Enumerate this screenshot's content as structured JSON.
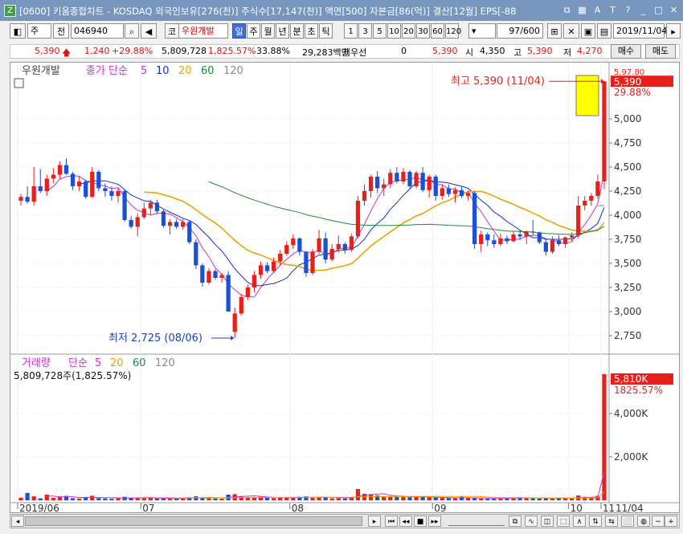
{
  "window": {
    "badge": "Z",
    "title": "[0600] 키움종합차트 - KOSDAQ 외국인보유[276(천)] 주식수[17,147(천)] 액면[500] 자본금[86(억)] 결산[12월] EPS[-88",
    "icons": [
      "restore-icon",
      "grid-icon",
      "font-size-icon",
      "help-icon",
      "settings-icon",
      "minimize-icon",
      "maximize-icon",
      "close-icon"
    ],
    "icon_glyphs": [
      "⧉",
      "▦",
      "A",
      "T",
      "?",
      "_",
      "□",
      "✕"
    ]
  },
  "toolbar": {
    "period_select": "주",
    "prev_button": "전",
    "code_value": "046940",
    "market_badge": "코",
    "stock_name": "우원개발",
    "tabs": [
      "일",
      "주",
      "월",
      "년",
      "분",
      "초",
      "틱"
    ],
    "active_tab": "일",
    "minute_steps": [
      "1",
      "3",
      "5",
      "10",
      "20",
      "30",
      "60",
      "120"
    ],
    "count_value": "97/600",
    "date_value": "2019/11/04",
    "buy_button": "매수",
    "sell_button": "매도"
  },
  "quote": {
    "price": "5,390",
    "change": "1,240",
    "change_pct": "+29.88%",
    "volume": "5,809,728",
    "volume_pct": "1,825.57%",
    "turnover_pct": "33.88%",
    "amount": "29,283백만",
    "priority_label": "최우선",
    "priority_value": "0",
    "ask": "5,390",
    "open_label": "시",
    "open": "4,350",
    "high_label": "고",
    "high": "5,390",
    "low_label": "저",
    "low": "4,270"
  },
  "chart_data": [
    {
      "type": "candlestick",
      "legend_name": "우원개발",
      "ma_label": "종가 단순",
      "ma_periods": [
        "5",
        "10",
        "20",
        "60",
        "120"
      ],
      "ma_colors": [
        "#cc2fcc",
        "#1a2bd0",
        "#e8a400",
        "#1f8a3a",
        "#8a8a8a"
      ],
      "ylim": [
        2600,
        5500
      ],
      "y_ticks": [
        2750,
        3000,
        3250,
        3500,
        3750,
        4000,
        4250,
        4500,
        4750,
        5000
      ],
      "y_tick_labels": [
        "2,750",
        "3,000",
        "3,250",
        "3,500",
        "3,750",
        "4,000",
        "4,250",
        "4,500",
        "4,750",
        "5,000"
      ],
      "last_price_label": "5,390",
      "last_price_pct": "29.88%",
      "top_hint": "5,97.80",
      "high_annotation": "최고 5,390 (11/04)",
      "low_annotation": "최저 2,725 (08/06)",
      "x_labels": [
        "2019/06",
        "07",
        "08",
        "09",
        "10",
        "11",
        "11/04"
      ],
      "candles": [
        {
          "o": 4150,
          "h": 4220,
          "l": 4100,
          "c": 4190
        },
        {
          "o": 4190,
          "h": 4300,
          "l": 4120,
          "c": 4140
        },
        {
          "o": 4140,
          "h": 4500,
          "l": 4100,
          "c": 4300
        },
        {
          "o": 4300,
          "h": 4480,
          "l": 4230,
          "c": 4250
        },
        {
          "o": 4250,
          "h": 4420,
          "l": 4200,
          "c": 4380
        },
        {
          "o": 4380,
          "h": 4490,
          "l": 4330,
          "c": 4420
        },
        {
          "o": 4420,
          "h": 4560,
          "l": 4380,
          "c": 4520
        },
        {
          "o": 4520,
          "h": 4590,
          "l": 4420,
          "c": 4430
        },
        {
          "o": 4430,
          "h": 4450,
          "l": 4260,
          "c": 4300
        },
        {
          "o": 4300,
          "h": 4400,
          "l": 4250,
          "c": 4350
        },
        {
          "o": 4350,
          "h": 4370,
          "l": 4170,
          "c": 4190
        },
        {
          "o": 4190,
          "h": 4500,
          "l": 4180,
          "c": 4450
        },
        {
          "o": 4450,
          "h": 4470,
          "l": 4250,
          "c": 4280
        },
        {
          "o": 4280,
          "h": 4330,
          "l": 4190,
          "c": 4250
        },
        {
          "o": 4250,
          "h": 4300,
          "l": 4150,
          "c": 4200
        },
        {
          "o": 4200,
          "h": 4280,
          "l": 4130,
          "c": 4250
        },
        {
          "o": 4250,
          "h": 4260,
          "l": 3930,
          "c": 3950
        },
        {
          "o": 3950,
          "h": 3990,
          "l": 3860,
          "c": 3880
        },
        {
          "o": 3880,
          "h": 4020,
          "l": 3780,
          "c": 3980
        },
        {
          "o": 3980,
          "h": 4130,
          "l": 3960,
          "c": 4070
        },
        {
          "o": 4070,
          "h": 4160,
          "l": 4000,
          "c": 4130
        },
        {
          "o": 4130,
          "h": 4160,
          "l": 4010,
          "c": 4040
        },
        {
          "o": 4040,
          "h": 4060,
          "l": 3870,
          "c": 3890
        },
        {
          "o": 3890,
          "h": 3960,
          "l": 3800,
          "c": 3930
        },
        {
          "o": 3930,
          "h": 3960,
          "l": 3860,
          "c": 3880
        },
        {
          "o": 3880,
          "h": 3960,
          "l": 3850,
          "c": 3930
        },
        {
          "o": 3930,
          "h": 3950,
          "l": 3700,
          "c": 3720
        },
        {
          "o": 3720,
          "h": 3750,
          "l": 3440,
          "c": 3480
        },
        {
          "o": 3480,
          "h": 3500,
          "l": 3260,
          "c": 3300
        },
        {
          "o": 3300,
          "h": 3450,
          "l": 3280,
          "c": 3420
        },
        {
          "o": 3420,
          "h": 3440,
          "l": 3330,
          "c": 3350
        },
        {
          "o": 3350,
          "h": 3400,
          "l": 3300,
          "c": 3380
        },
        {
          "o": 3380,
          "h": 3420,
          "l": 3000,
          "c": 3000
        },
        {
          "o": 2790,
          "h": 3040,
          "l": 2725,
          "c": 2980
        },
        {
          "o": 2980,
          "h": 3180,
          "l": 2960,
          "c": 3150
        },
        {
          "o": 3150,
          "h": 3280,
          "l": 3120,
          "c": 3250
        },
        {
          "o": 3250,
          "h": 3420,
          "l": 3200,
          "c": 3380
        },
        {
          "o": 3380,
          "h": 3520,
          "l": 3340,
          "c": 3480
        },
        {
          "o": 3480,
          "h": 3510,
          "l": 3400,
          "c": 3420
        },
        {
          "o": 3420,
          "h": 3560,
          "l": 3400,
          "c": 3520
        },
        {
          "o": 3520,
          "h": 3640,
          "l": 3480,
          "c": 3600
        },
        {
          "o": 3600,
          "h": 3730,
          "l": 3580,
          "c": 3690
        },
        {
          "o": 3690,
          "h": 3800,
          "l": 3650,
          "c": 3760
        },
        {
          "o": 3760,
          "h": 3770,
          "l": 3580,
          "c": 3620
        },
        {
          "o": 3620,
          "h": 3630,
          "l": 3360,
          "c": 3400
        },
        {
          "o": 3400,
          "h": 3650,
          "l": 3380,
          "c": 3620
        },
        {
          "o": 3620,
          "h": 3850,
          "l": 3600,
          "c": 3760
        },
        {
          "o": 3760,
          "h": 3820,
          "l": 3500,
          "c": 3540
        },
        {
          "o": 3540,
          "h": 3700,
          "l": 3520,
          "c": 3650
        },
        {
          "o": 3650,
          "h": 3790,
          "l": 3610,
          "c": 3700
        },
        {
          "o": 3700,
          "h": 3720,
          "l": 3600,
          "c": 3640
        },
        {
          "o": 3640,
          "h": 3810,
          "l": 3620,
          "c": 3780
        },
        {
          "o": 3780,
          "h": 4200,
          "l": 3760,
          "c": 4150
        },
        {
          "o": 4150,
          "h": 4320,
          "l": 4100,
          "c": 4250
        },
        {
          "o": 4250,
          "h": 4420,
          "l": 4180,
          "c": 4400
        },
        {
          "o": 4400,
          "h": 4460,
          "l": 4230,
          "c": 4280
        },
        {
          "o": 4280,
          "h": 4380,
          "l": 4200,
          "c": 4320
        },
        {
          "o": 4320,
          "h": 4480,
          "l": 4280,
          "c": 4440
        },
        {
          "o": 4440,
          "h": 4500,
          "l": 4330,
          "c": 4350
        },
        {
          "o": 4350,
          "h": 4490,
          "l": 4320,
          "c": 4450
        },
        {
          "o": 4450,
          "h": 4470,
          "l": 4280,
          "c": 4300
        },
        {
          "o": 4300,
          "h": 4460,
          "l": 4280,
          "c": 4440
        },
        {
          "o": 4440,
          "h": 4500,
          "l": 4240,
          "c": 4260
        },
        {
          "o": 4260,
          "h": 4420,
          "l": 4180,
          "c": 4400
        },
        {
          "o": 4400,
          "h": 4420,
          "l": 4150,
          "c": 4200
        },
        {
          "o": 4200,
          "h": 4320,
          "l": 4160,
          "c": 4280
        },
        {
          "o": 4280,
          "h": 4320,
          "l": 4190,
          "c": 4220
        },
        {
          "o": 4220,
          "h": 4290,
          "l": 4130,
          "c": 4260
        },
        {
          "o": 4260,
          "h": 4300,
          "l": 4180,
          "c": 4200
        },
        {
          "o": 4200,
          "h": 4260,
          "l": 4150,
          "c": 4230
        },
        {
          "o": 4230,
          "h": 4250,
          "l": 3650,
          "c": 3700
        },
        {
          "o": 3700,
          "h": 3840,
          "l": 3620,
          "c": 3800
        },
        {
          "o": 3800,
          "h": 3820,
          "l": 3680,
          "c": 3740
        },
        {
          "o": 3740,
          "h": 3800,
          "l": 3660,
          "c": 3700
        },
        {
          "o": 3700,
          "h": 3810,
          "l": 3680,
          "c": 3760
        },
        {
          "o": 3760,
          "h": 3790,
          "l": 3700,
          "c": 3730
        },
        {
          "o": 3730,
          "h": 3830,
          "l": 3720,
          "c": 3800
        },
        {
          "o": 3800,
          "h": 3850,
          "l": 3740,
          "c": 3780
        },
        {
          "o": 3780,
          "h": 3840,
          "l": 3700,
          "c": 3830
        },
        {
          "o": 3830,
          "h": 3950,
          "l": 3790,
          "c": 3820
        },
        {
          "o": 3820,
          "h": 3830,
          "l": 3700,
          "c": 3720
        },
        {
          "o": 3720,
          "h": 3750,
          "l": 3580,
          "c": 3620
        },
        {
          "o": 3620,
          "h": 3780,
          "l": 3600,
          "c": 3740
        },
        {
          "o": 3740,
          "h": 3790,
          "l": 3680,
          "c": 3700
        },
        {
          "o": 3700,
          "h": 3780,
          "l": 3660,
          "c": 3770
        },
        {
          "o": 3770,
          "h": 3820,
          "l": 3730,
          "c": 3790
        },
        {
          "o": 3790,
          "h": 4200,
          "l": 3760,
          "c": 4100
        },
        {
          "o": 4100,
          "h": 4200,
          "l": 4050,
          "c": 4150
        },
        {
          "o": 4150,
          "h": 4230,
          "l": 4100,
          "c": 4200
        },
        {
          "o": 4200,
          "h": 4420,
          "l": 4170,
          "c": 4350
        },
        {
          "o": 4350,
          "h": 5390,
          "l": 4270,
          "c": 5390
        }
      ]
    },
    {
      "type": "bar",
      "legend_name": "거래량",
      "ma_label": "단순",
      "ma_periods": [
        "5",
        "20",
        "60",
        "120"
      ],
      "ma_colors": [
        "#cc2fcc",
        "#e8a400",
        "#1f8a3a",
        "#8a8a8a"
      ],
      "value_caption": "5,809,728주(1,825.57%)",
      "last_volume_label": "5,810K",
      "last_volume_pct": "1825.57%",
      "ylim": [
        0,
        6400
      ],
      "y_ticks": [
        2000,
        4000
      ],
      "y_tick_labels": [
        "2,000K",
        "4,000K"
      ],
      "unit": "K",
      "values": [
        120,
        340,
        180,
        90,
        260,
        110,
        150,
        200,
        95,
        80,
        140,
        210,
        100,
        85,
        70,
        90,
        160,
        120,
        110,
        90,
        100,
        80,
        95,
        85,
        70,
        100,
        140,
        180,
        120,
        90,
        80,
        70,
        260,
        280,
        180,
        150,
        140,
        160,
        120,
        100,
        130,
        110,
        120,
        160,
        180,
        110,
        140,
        150,
        90,
        100,
        80,
        120,
        520,
        300,
        280,
        220,
        180,
        170,
        150,
        180,
        140,
        160,
        150,
        130,
        120,
        110,
        100,
        90,
        160,
        110,
        90,
        80,
        70,
        90,
        80,
        100,
        120,
        140,
        110,
        90,
        80,
        100,
        110,
        120,
        90,
        80,
        220,
        160,
        140,
        200,
        5810
      ]
    }
  ]
}
